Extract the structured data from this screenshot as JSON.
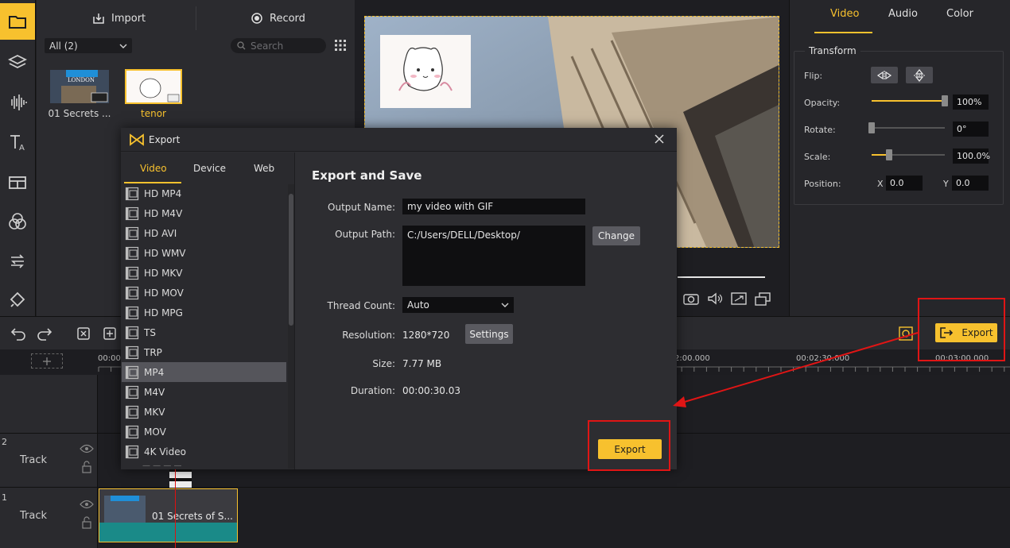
{
  "media": {
    "import_label": "Import",
    "record_label": "Record",
    "filter_value": "All (2)",
    "search_placeholder": "Search",
    "items": [
      {
        "label": "01 Secrets ..."
      },
      {
        "label": "tenor"
      }
    ],
    "thumb_text": "LONDON"
  },
  "properties": {
    "tabs": [
      "Video",
      "Audio",
      "Color"
    ],
    "section_title": "Transform",
    "flip_label": "Flip:",
    "opacity_label": "Opacity:",
    "opacity_value": "100%",
    "rotate_label": "Rotate:",
    "rotate_value": "0°",
    "scale_label": "Scale:",
    "scale_value": "100.0%",
    "position_label": "Position:",
    "pos_x_label": "X",
    "pos_x_value": "0.0",
    "pos_y_label": "Y",
    "pos_y_value": "0.0"
  },
  "timeline": {
    "export_label": "Export",
    "ticks": [
      "00:00",
      "2:00.000",
      "00:02:30.000",
      "00:03:00.000"
    ],
    "tracks": [
      {
        "number": "2",
        "name": "Track"
      },
      {
        "number": "1",
        "name": "Track"
      }
    ],
    "clip_label": "01 Secrets of S..."
  },
  "dialog": {
    "title": "Export",
    "tabs": [
      "Video",
      "Device",
      "Web"
    ],
    "formats": [
      "HD MP4",
      "HD M4V",
      "HD AVI",
      "HD WMV",
      "HD MKV",
      "HD MOV",
      "HD MPG",
      "TS",
      "TRP",
      "MP4",
      "M4V",
      "MKV",
      "MOV",
      "4K Video"
    ],
    "selected_format": "MP4",
    "heading": "Export and Save",
    "output_name_label": "Output Name:",
    "output_name_value": "my video with GIF",
    "output_path_label": "Output Path:",
    "output_path_value": "C:/Users/DELL/Desktop/",
    "change_label": "Change",
    "thread_count_label": "Thread Count:",
    "thread_count_value": "Auto",
    "resolution_label": "Resolution:",
    "resolution_value": "1280*720",
    "settings_label": "Settings",
    "size_label": "Size:",
    "size_value": "7.77 MB",
    "duration_label": "Duration:",
    "duration_value": "00:00:30.03",
    "export_label": "Export"
  },
  "colors": {
    "accent": "#f7c12e",
    "annotation": "#e01515"
  }
}
